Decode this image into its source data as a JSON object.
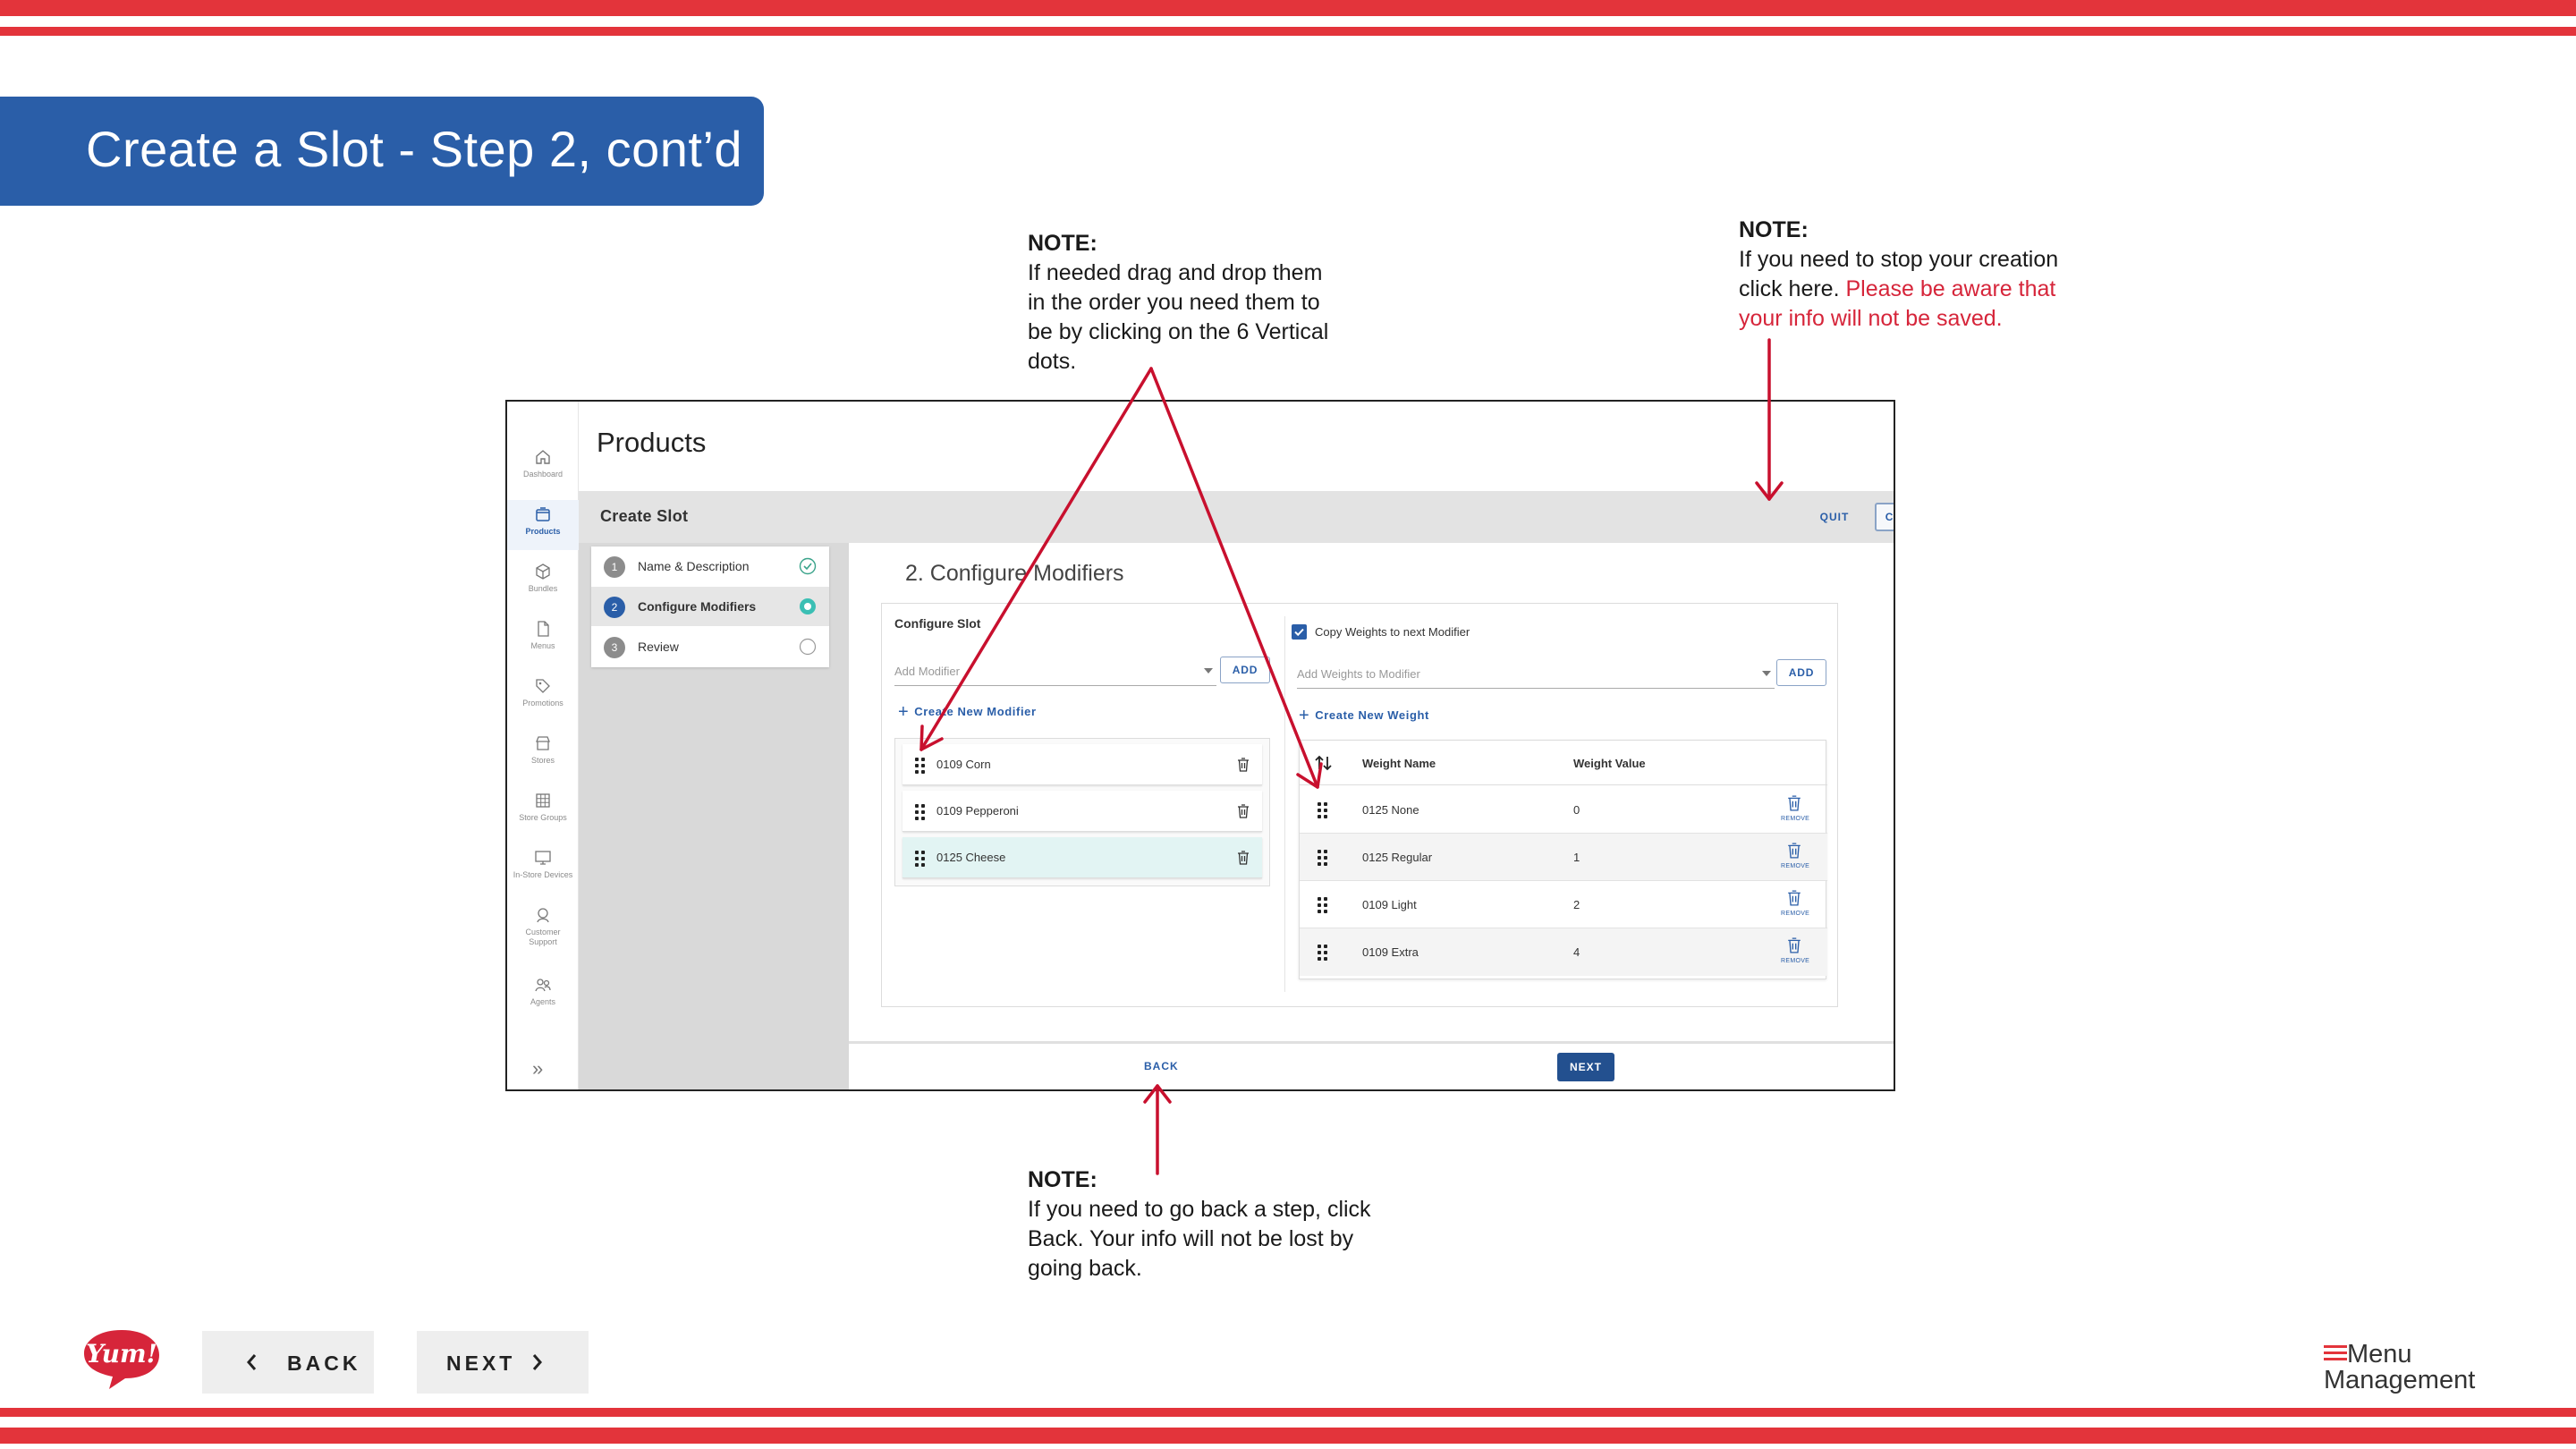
{
  "slide": {
    "title": "Create a Slot - Step 2, cont’d"
  },
  "notes": {
    "drag": {
      "heading": "NOTE:",
      "lines": [
        "If needed drag and drop them",
        "in the order you need them to",
        "be by clicking on the 6 Vertical",
        "dots."
      ]
    },
    "quit": {
      "heading": "NOTE:",
      "line1": "If you need to stop your creation",
      "line2_plain": "click here. ",
      "line2_warn": "Please be aware that",
      "line3_warn": "your info will not be saved."
    },
    "back": {
      "heading": "NOTE:",
      "lines": [
        "If you need to go back a step, click",
        "Back. Your info will not be lost by",
        "going back."
      ]
    }
  },
  "app": {
    "page_title": "Products",
    "bar_title": "Create Slot",
    "quit_label": "QUIT",
    "create_label": "CREATE",
    "rail": [
      {
        "label": "Dashboard",
        "icon": "home-icon"
      },
      {
        "label": "Products",
        "icon": "box-icon",
        "active": true
      },
      {
        "label": "Bundles",
        "icon": "cube-icon"
      },
      {
        "label": "Menus",
        "icon": "document-icon"
      },
      {
        "label": "Promotions",
        "icon": "tag-icon"
      },
      {
        "label": "Stores",
        "icon": "store-icon"
      },
      {
        "label": "Store Groups",
        "icon": "grid-icon"
      },
      {
        "label": "In-Store Devices",
        "icon": "monitor-icon"
      },
      {
        "label": "Customer Support",
        "icon": "support-icon"
      },
      {
        "label": "Agents",
        "icon": "people-icon"
      }
    ],
    "collapse_glyph": "»",
    "steps": [
      {
        "num": "1",
        "label": "Name & Description",
        "state": "done"
      },
      {
        "num": "2",
        "label": "Configure Modifiers",
        "state": "current"
      },
      {
        "num": "3",
        "label": "Review",
        "state": "todo"
      }
    ],
    "section_title": "2. Configure Modifiers",
    "configure_slot": "Configure Slot",
    "add_modifier_placeholder": "Add Modifier",
    "add_label": "ADD",
    "create_modifier": "Create New Modifier",
    "modifiers": [
      "0109 Corn",
      "0109 Pepperoni",
      "0125 Cheese"
    ],
    "copy_weights": "Copy Weights to next Modifier",
    "add_weights_placeholder": "Add Weights to Modifier",
    "create_weight": "Create New Weight",
    "weight_headers": {
      "name": "Weight Name",
      "value": "Weight Value"
    },
    "weights": [
      {
        "name": "0125 None",
        "value": "0"
      },
      {
        "name": "0125 Regular",
        "value": "1"
      },
      {
        "name": "0109 Light",
        "value": "2"
      },
      {
        "name": "0109 Extra",
        "value": "4"
      }
    ],
    "remove_label": "REMOVE",
    "back_label": "BACK",
    "next_label": "NEXT"
  },
  "footer": {
    "back_label": "BACK",
    "next_label": "NEXT",
    "brand": "Yum!",
    "product_line1": "Menu",
    "product_line2": "Management"
  },
  "colors": {
    "stripe_red": "#e3343b",
    "banner_blue": "#2a5ea8",
    "warning_red": "#d6253a",
    "arrow_red": "#c8102e"
  }
}
